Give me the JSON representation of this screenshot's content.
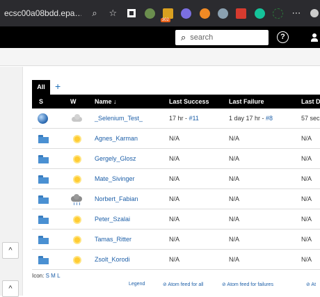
{
  "browser": {
    "url": "ecsc00a08bdd.epa…",
    "badge": "302"
  },
  "header": {
    "search_placeholder": "search",
    "help": "?"
  },
  "tabs": {
    "all": "All",
    "add": "+"
  },
  "table": {
    "headers": {
      "s": "S",
      "w": "W",
      "name": "Name ↓",
      "last_success": "Last Success",
      "last_failure": "Last Failure",
      "last_duration": "Last Du"
    },
    "rows": [
      {
        "name": "_Selenium_Test_",
        "status": "blue-ball",
        "weather": "cloudy",
        "last_success": "17 hr - ",
        "last_success_build": "#11",
        "last_failure": "1 day 17 hr - ",
        "last_failure_build": "#8",
        "last_duration": "57 sec"
      },
      {
        "name": "Agnes_Karman",
        "status": "folder",
        "weather": "sunny",
        "last_success": "N/A",
        "last_failure": "N/A",
        "last_duration": "N/A"
      },
      {
        "name": "Gergely_Glosz",
        "status": "folder",
        "weather": "sunny",
        "last_success": "N/A",
        "last_failure": "N/A",
        "last_duration": "N/A"
      },
      {
        "name": "Mate_Sivinger",
        "status": "folder",
        "weather": "sunny",
        "last_success": "N/A",
        "last_failure": "N/A",
        "last_duration": "N/A"
      },
      {
        "name": "Norbert_Fabian",
        "status": "folder",
        "weather": "stormy",
        "last_success": "N/A",
        "last_failure": "N/A",
        "last_duration": "N/A"
      },
      {
        "name": "Peter_Szalai",
        "status": "folder",
        "weather": "sunny",
        "last_success": "N/A",
        "last_failure": "N/A",
        "last_duration": "N/A"
      },
      {
        "name": "Tamas_Ritter",
        "status": "folder",
        "weather": "sunny",
        "last_success": "N/A",
        "last_failure": "N/A",
        "last_duration": "N/A"
      },
      {
        "name": "Zsolt_Korodi",
        "status": "folder",
        "weather": "sunny",
        "last_success": "N/A",
        "last_failure": "N/A",
        "last_duration": "N/A"
      }
    ]
  },
  "footer": {
    "icon_label": "Icon:",
    "sizes": [
      "S",
      "M",
      "L"
    ],
    "legend": "Legend",
    "atom_all": "⊘ Atom feed for all",
    "atom_failures": "⊘ Atom feed for failures",
    "atom_more": "⊘ At"
  },
  "colors": {
    "link": "#1d5fa8",
    "header_bg": "#000000",
    "chrome_bg": "#2b2b2f"
  }
}
